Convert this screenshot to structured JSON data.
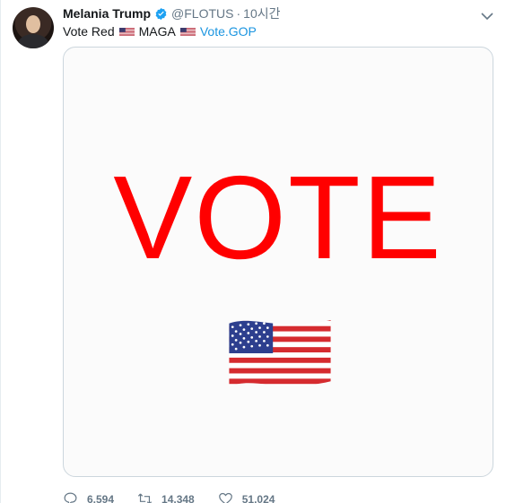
{
  "tweet": {
    "author_name": "Melania Trump",
    "author_handle": "@FLOTUS",
    "separator": "·",
    "timestamp": "10시간",
    "text_part1": "Vote Red",
    "text_part2": "MAGA",
    "link_text": "Vote.GOP",
    "image_text": "VOTE"
  },
  "actions": {
    "reply_count": "6,594",
    "retweet_count": "14,348",
    "like_count": "51,024"
  },
  "icons": {
    "verified": "verified-badge-icon",
    "menu": "chevron-down-icon",
    "reply": "reply-icon",
    "retweet": "retweet-icon",
    "like": "heart-icon",
    "flag": "us-flag-icon"
  },
  "colors": {
    "vote_red": "#ff0000",
    "link_blue": "#1b95e0",
    "muted": "#657786"
  }
}
